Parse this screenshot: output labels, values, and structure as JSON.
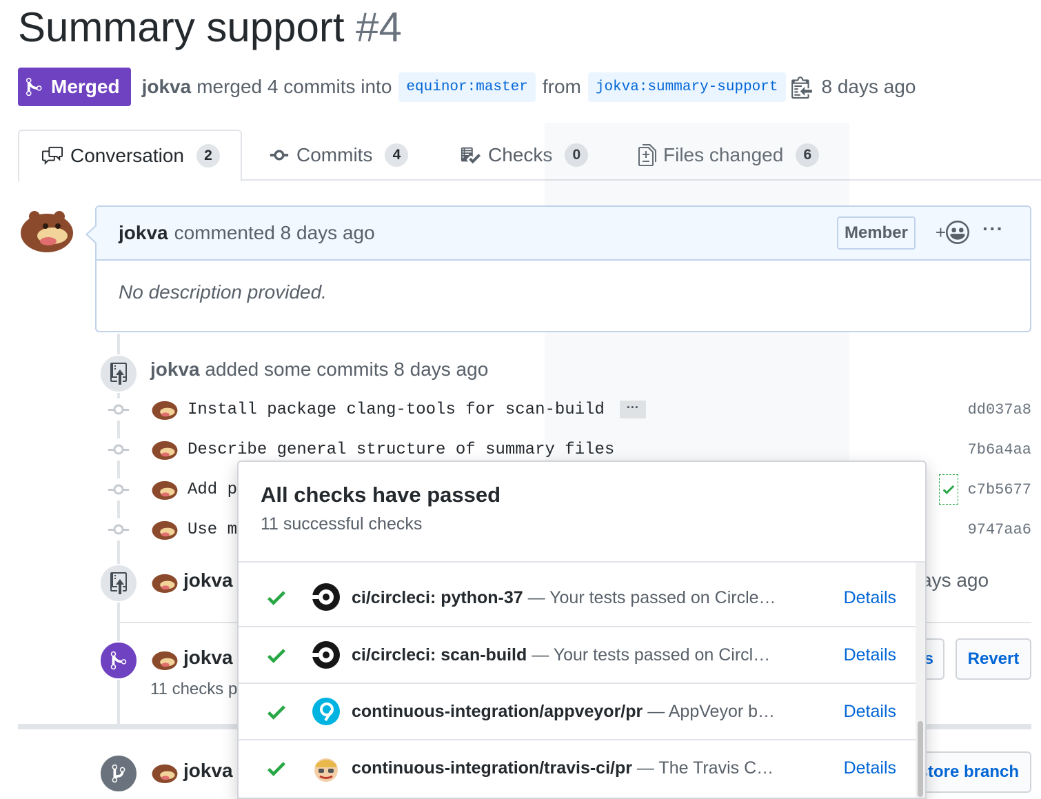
{
  "pr": {
    "title": "Summary support",
    "number": "#4",
    "state_label": "Merged",
    "author": "jokva",
    "merged_text": "merged 4 commits into",
    "base_branch": "equinor:master",
    "from_text": "from",
    "head_branch": "jokva:summary-support",
    "time_ago": "8 days ago"
  },
  "tabs": [
    {
      "label": "Conversation",
      "count": "2",
      "icon": "comment-discussion-icon"
    },
    {
      "label": "Commits",
      "count": "4",
      "icon": "git-commit-icon"
    },
    {
      "label": "Checks",
      "count": "0",
      "icon": "checklist-icon"
    },
    {
      "label": "Files changed",
      "count": "6",
      "icon": "diff-icon"
    }
  ],
  "comment": {
    "author": "jokva",
    "action": "commented 8 days ago",
    "badge": "Member",
    "reaction_plus": "+",
    "more": "···",
    "body": "No description provided."
  },
  "timeline": {
    "commits_event": {
      "author": "jokva",
      "text": "added some commits 8 days ago"
    },
    "commits": [
      {
        "message": "Install package clang-tools for scan-build",
        "ellipsis": "···",
        "sha": "dd037a8"
      },
      {
        "message": "Describe general structure of summary files",
        "sha": "7b6a4aa"
      },
      {
        "message": "Add pa",
        "sha": "c7b5677"
      },
      {
        "message": "Use me",
        "sha": "9747aa6"
      }
    ],
    "push_event": {
      "author": "jokva",
      "tail": "ays ago"
    },
    "merge_event": {
      "author": "jokva",
      "sub": "11 checks p",
      "btn_partial": "s",
      "revert": "Revert"
    },
    "branch_event": {
      "author": "jokva",
      "restore": "store branch"
    }
  },
  "checks_popover": {
    "title": "All checks have passed",
    "subtitle": "11 successful checks",
    "items": [
      {
        "name": "ci/circleci: python-37",
        "desc": " — Your tests passed on Circle…",
        "details": "Details",
        "logo": "circleci-logo-icon"
      },
      {
        "name": "ci/circleci: scan-build",
        "desc": " — Your tests passed on Circl…",
        "details": "Details",
        "logo": "circleci-logo-icon"
      },
      {
        "name": "continuous-integration/appveyor/pr",
        "desc": " — AppVeyor b…",
        "details": "Details",
        "logo": "appveyor-logo-icon"
      },
      {
        "name": "continuous-integration/travis-ci/pr",
        "desc": " — The Travis C…",
        "details": "Details",
        "logo": "travis-logo-icon"
      }
    ]
  },
  "colors": {
    "merged": "#6f42c1",
    "link": "#0366d6",
    "success": "#28a745",
    "comment_border": "#c0d3eb",
    "comment_header": "#f1f8ff"
  }
}
